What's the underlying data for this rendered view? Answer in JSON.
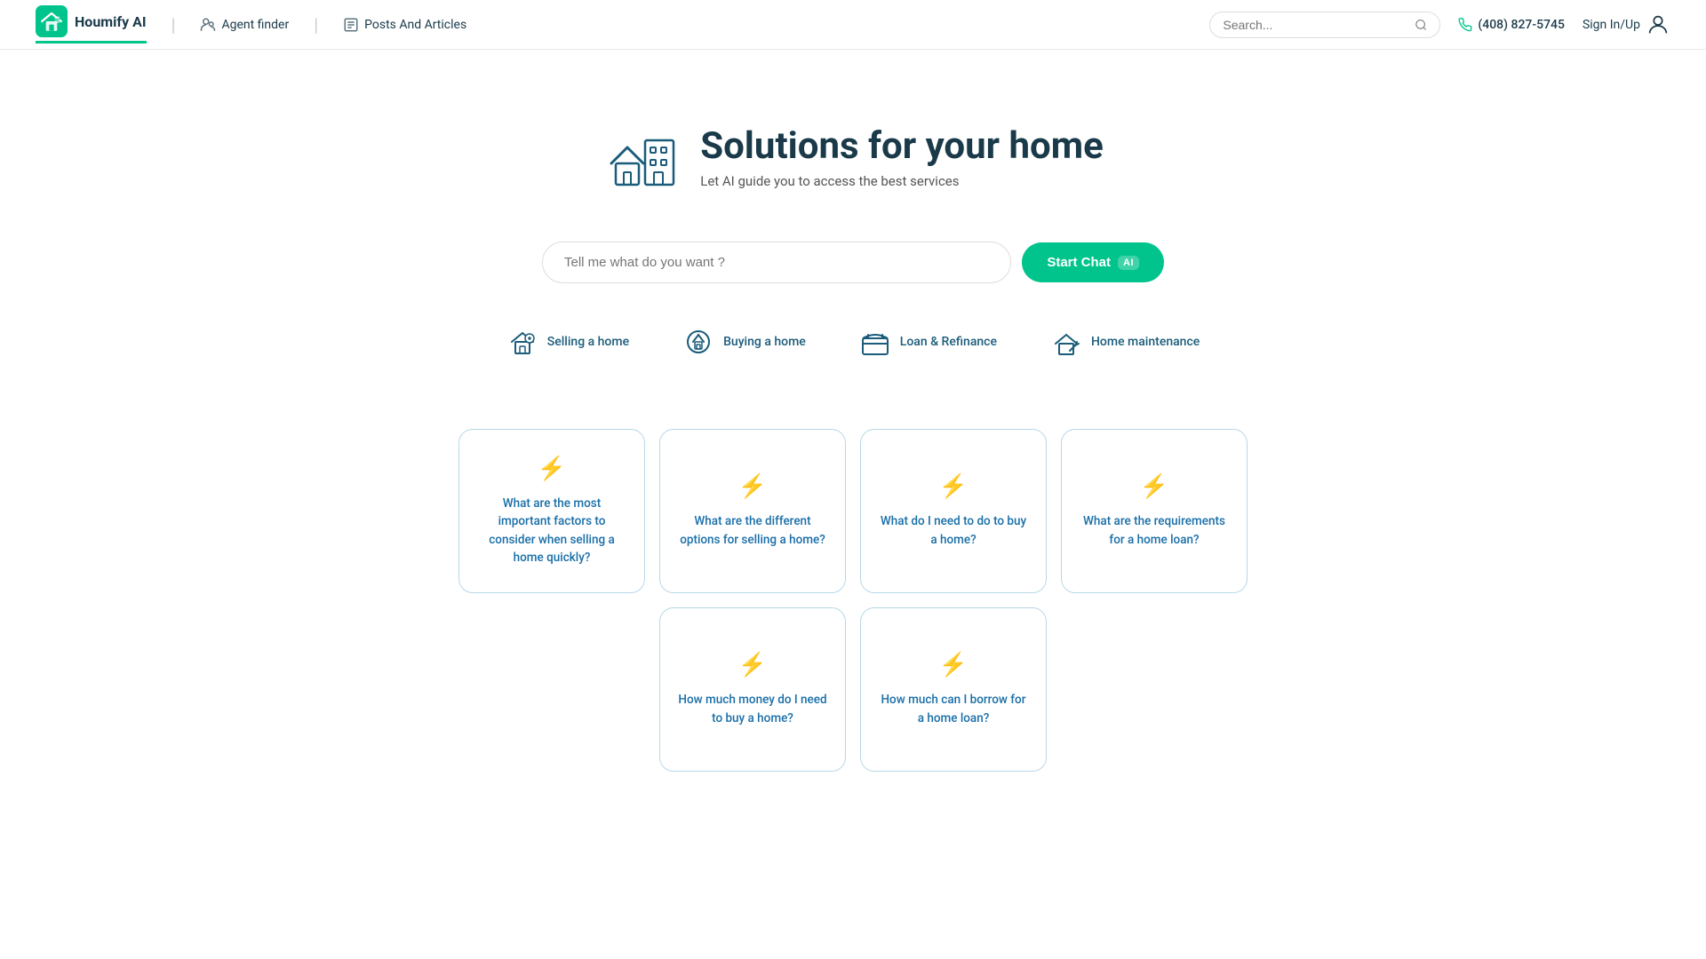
{
  "navbar": {
    "logo_text": "Houmify AI",
    "agent_finder_label": "Agent finder",
    "posts_articles_label": "Posts And Articles",
    "search_placeholder": "Search...",
    "phone_number": "(408) 827-5745",
    "sign_in_label": "Sign In/Up"
  },
  "hero": {
    "title": "Solutions for your home",
    "subtitle": "Let AI guide you to access the best services",
    "search_placeholder": "Tell me what do you want ?",
    "start_chat_label": "Start Chat",
    "ai_badge": "AI"
  },
  "categories": [
    {
      "id": "selling",
      "label": "Selling a home"
    },
    {
      "id": "buying",
      "label": "Buying a home"
    },
    {
      "id": "loan",
      "label": "Loan & Refinance"
    },
    {
      "id": "maintenance",
      "label": "Home maintenance"
    }
  ],
  "cards_row1": [
    {
      "text": "What are the most important factors to consider when selling a home quickly?"
    },
    {
      "text": "What are the different options for selling a home?"
    },
    {
      "text": "What do I need to do to buy a home?"
    },
    {
      "text": "What are the requirements for a home loan?"
    }
  ],
  "cards_row2": [
    {
      "text": "How much money do I need to buy a home?"
    },
    {
      "text": "How much can I borrow for a home loan?"
    }
  ]
}
